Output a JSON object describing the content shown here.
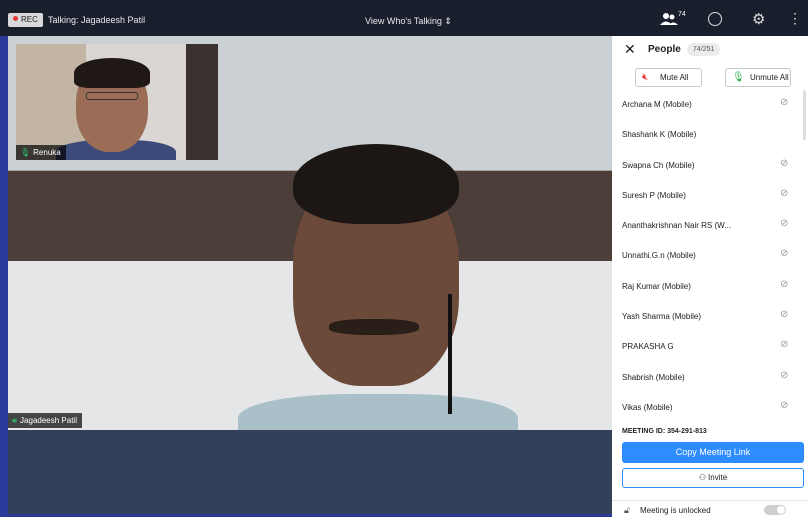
{
  "topbar": {
    "rec_label": "REC",
    "talking": "Talking: Jagadeesh Patil",
    "view_who": "View Who's Talking ⇕",
    "participants_count": "74",
    "gear_icon": "⚙",
    "more_icon": "⋮"
  },
  "main_video": {
    "speaker_name": "Jagadeesh Patil"
  },
  "thumbnail": {
    "name": "Renuka"
  },
  "panel": {
    "close": "✕",
    "title": "People",
    "count": "74/251",
    "mute_all": "Mute All",
    "unmute_all": "Unmute All",
    "participants": [
      {
        "name": "Archana M (Mobile)",
        "muted_icon": "mic-off-icon"
      },
      {
        "name": "Shashank K (Mobile)",
        "muted_icon": ""
      },
      {
        "name": "Swapna Ch (Mobile)",
        "muted_icon": "mic-off-icon"
      },
      {
        "name": "Suresh P (Mobile)",
        "muted_icon": "mic-off-icon"
      },
      {
        "name": "Ananthakrishnan Nair RS (W...",
        "muted_icon": "mic-off-icon"
      },
      {
        "name": "Unnathi.G.n (Mobile)",
        "muted_icon": "mic-off-icon"
      },
      {
        "name": "Raj Kumar (Mobile)",
        "muted_icon": "mic-off-icon"
      },
      {
        "name": "Yash Sharma (Mobile)",
        "muted_icon": "mic-off-icon"
      },
      {
        "name": "PRAKASHA G",
        "muted_icon": "mic-off-icon"
      },
      {
        "name": "Shabrish (Mobile)",
        "muted_icon": "mic-off-icon"
      },
      {
        "name": "Vikas (Mobile)",
        "muted_icon": "mic-off-icon"
      }
    ],
    "meeting_id": "MEETING ID: 354-291-813",
    "copy_link": "Copy Meeting Link",
    "invite": "Invite",
    "lock_status": "Meeting is unlocked"
  },
  "colors": {
    "accent": "#2d8cff",
    "topbar": "#1a1f2e",
    "border": "#2b3a9a"
  }
}
